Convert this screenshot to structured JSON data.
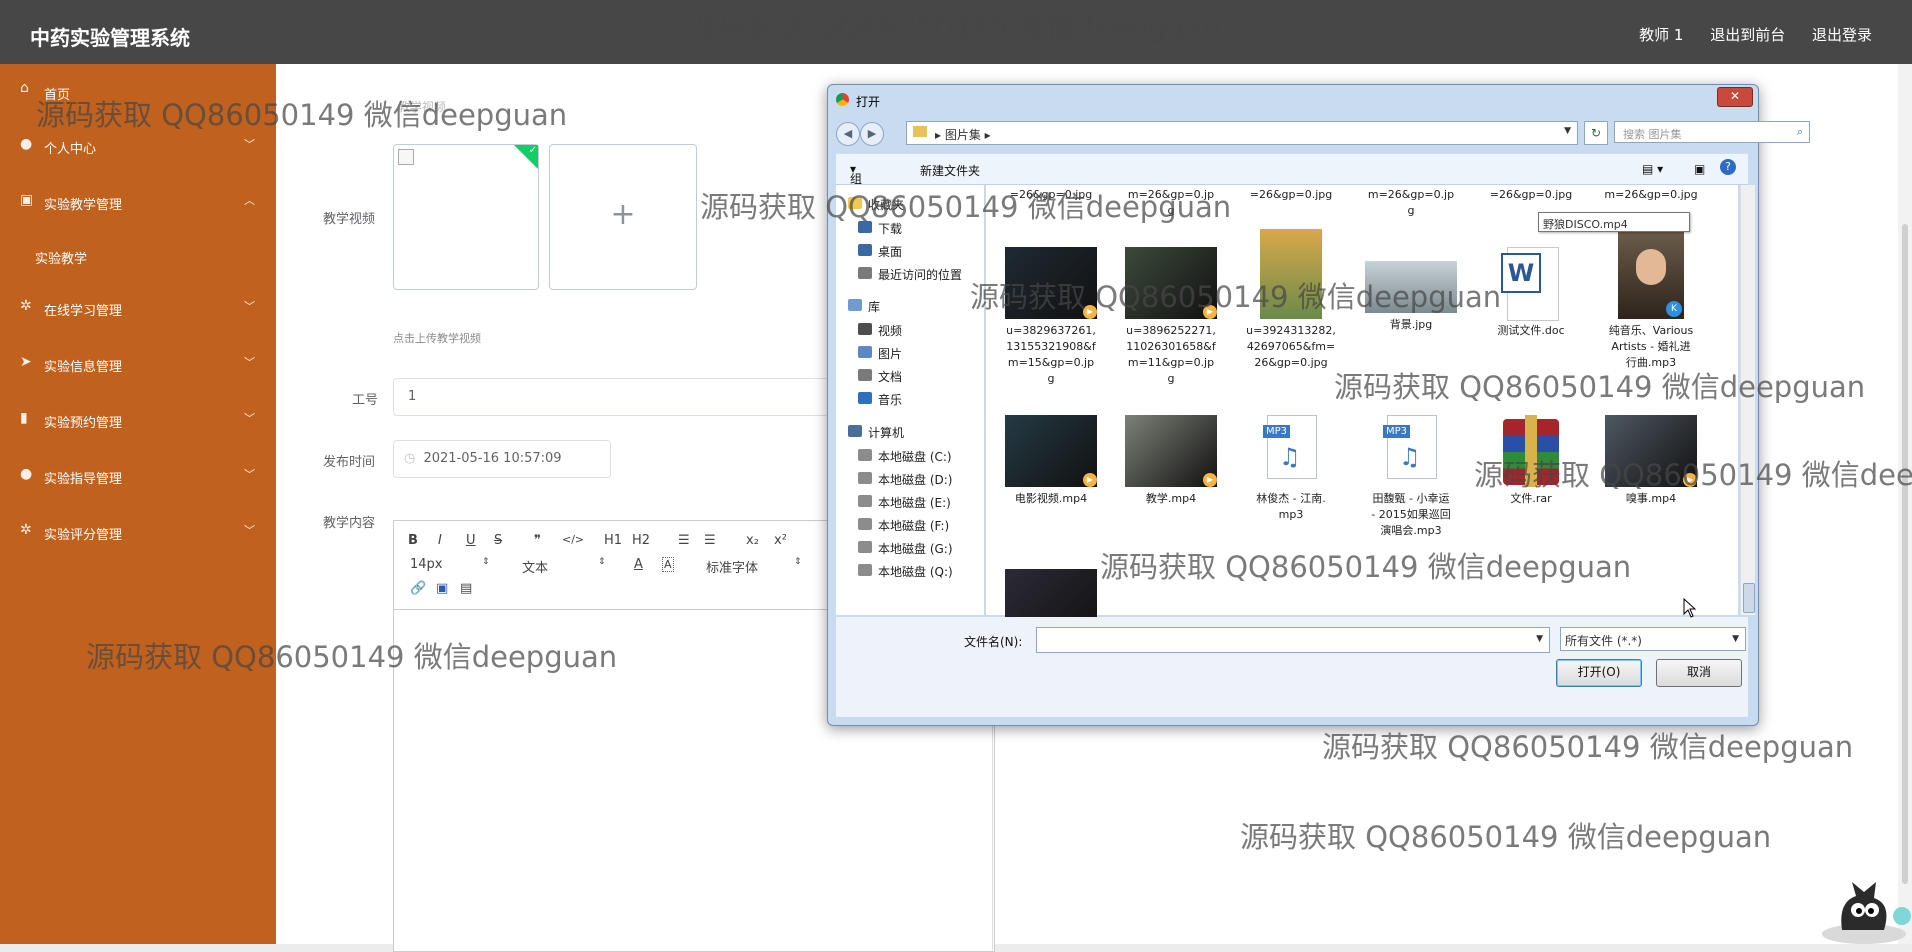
{
  "header": {
    "app_title": "中药实验管理系统",
    "user_name": "教师 1",
    "to_front": "退出到前台",
    "logout": "退出登录"
  },
  "sidebar": {
    "items": [
      {
        "label": "首页",
        "icon": "home-icon"
      },
      {
        "label": "个人中心",
        "icon": "user-icon"
      },
      {
        "label": "实验教学管理",
        "icon": "clipboard-icon"
      },
      {
        "label": "实验教学",
        "icon": ""
      },
      {
        "label": "在线学习管理",
        "icon": "gear-icon"
      },
      {
        "label": "实验信息管理",
        "icon": "send-icon"
      },
      {
        "label": "实验预约管理",
        "icon": "bar-chart-icon"
      },
      {
        "label": "实验指导管理",
        "icon": "user-icon"
      },
      {
        "label": "实验评分管理",
        "icon": "gear-icon"
      }
    ]
  },
  "form": {
    "video_label": "教学视频",
    "upload_hint": "点击上传教学视频",
    "staff_label": "工号",
    "staff_value": "1",
    "time_label": "发布时间",
    "time_value": "2021-05-16 10:57:09",
    "content_label": "教学内容",
    "obscured_label": "教学视频"
  },
  "editor": {
    "toolbar_row1": [
      "B",
      "I",
      "U",
      "S",
      "❞",
      "</>",
      "H1",
      "H2",
      "☰",
      "☰",
      "x₂",
      "x²"
    ],
    "font_size": "14px",
    "block_type": "文本",
    "font_family": "标准字体"
  },
  "dialog": {
    "title": "打开",
    "breadcrumb": "图片集",
    "search_placeholder": "搜索 图片集",
    "organize": "组织",
    "new_folder": "新建文件夹",
    "nav": [
      {
        "label": "收藏夹",
        "color": "#f2c94c",
        "indent": 0
      },
      {
        "label": "下载",
        "color": "#3a6aa5",
        "indent": 1
      },
      {
        "label": "桌面",
        "color": "#3a6aa5",
        "indent": 1
      },
      {
        "label": "最近访问的位置",
        "color": "#7a7a7a",
        "indent": 1
      },
      {
        "label": "库",
        "color": "#6f9bd0",
        "indent": 0
      },
      {
        "label": "视频",
        "color": "#4d4d4d",
        "indent": 1
      },
      {
        "label": "图片",
        "color": "#5b88c4",
        "indent": 1
      },
      {
        "label": "文档",
        "color": "#7a7a7a",
        "indent": 1
      },
      {
        "label": "音乐",
        "color": "#2f6fc0",
        "indent": 1
      },
      {
        "label": "计算机",
        "color": "#4a6e9a",
        "indent": 0
      },
      {
        "label": "本地磁盘 (C:)",
        "color": "#8c8c8c",
        "indent": 1
      },
      {
        "label": "本地磁盘 (D:)",
        "color": "#8c8c8c",
        "indent": 1
      },
      {
        "label": "本地磁盘 (E:)",
        "color": "#8c8c8c",
        "indent": 1
      },
      {
        "label": "本地磁盘 (F:)",
        "color": "#8c8c8c",
        "indent": 1
      },
      {
        "label": "本地磁盘 (G:)",
        "color": "#8c8c8c",
        "indent": 1
      },
      {
        "label": "本地磁盘 (Q:)",
        "color": "#8c8c8c",
        "indent": 1
      }
    ],
    "partial_row": [
      "=26&gp=0.jpg",
      "m=26&gp=0.jp\ng",
      "=26&gp=0.jpg",
      "m=26&gp=0.jp\ng",
      "=26&gp=0.jpg",
      "m=26&gp=0.jpg"
    ],
    "files": [
      {
        "name": "u=3829637261,\n13155321908&f\nm=15&gp=0.jp\ng",
        "kind": "video",
        "color": "#1f2a33"
      },
      {
        "name": "u=3896252271,\n11026301658&f\nm=11&gp=0.jp\ng",
        "kind": "video",
        "color": "#3c4a3a"
      },
      {
        "name": "u=3924313282,\n42697065&fm=\n26&gp=0.jpg",
        "kind": "poster",
        "color": "#d8a94a"
      },
      {
        "name": "背景.jpg",
        "kind": "image",
        "color": "#7b8a8f"
      },
      {
        "name": "测试文件.doc",
        "kind": "doc",
        "color": "#2b5797"
      },
      {
        "name": "纯音乐、Various\nArtists - 婚礼进\n行曲.mp3",
        "kind": "portrait",
        "color": "#5b3a2a"
      },
      {
        "name": "电影视频.mp4",
        "kind": "video",
        "color": "#243a44"
      },
      {
        "name": "教学.mp4",
        "kind": "video",
        "color": "#7d8177"
      },
      {
        "name": "林俊杰 - 江南.\nmp3",
        "kind": "mp3",
        "color": "#3a78c4"
      },
      {
        "name": "田馥甄 - 小幸运\n- 2015如果巡回\n演唱会.mp3",
        "kind": "mp3",
        "color": "#3a78c4"
      },
      {
        "name": "文件.rar",
        "kind": "rar",
        "color": "#a8242b"
      },
      {
        "name": "嗅事.mp4",
        "kind": "video",
        "color": "#4e5862"
      },
      {
        "name": "野狼DISCO.mp4",
        "kind": "video",
        "color": "#2c2a36"
      }
    ],
    "tooltip": "野狼DISCO.mp4",
    "filename_label": "文件名(N):",
    "filename_value": "",
    "filter_value": "所有文件 (*.*)",
    "open_button": "打开(O)",
    "cancel_button": "取消"
  },
  "watermark_text": "源码获取 QQ86050149 微信deepguan",
  "colors": {
    "sidebar": "#c1611e",
    "topbar": "#474747",
    "success": "#13ce66"
  }
}
